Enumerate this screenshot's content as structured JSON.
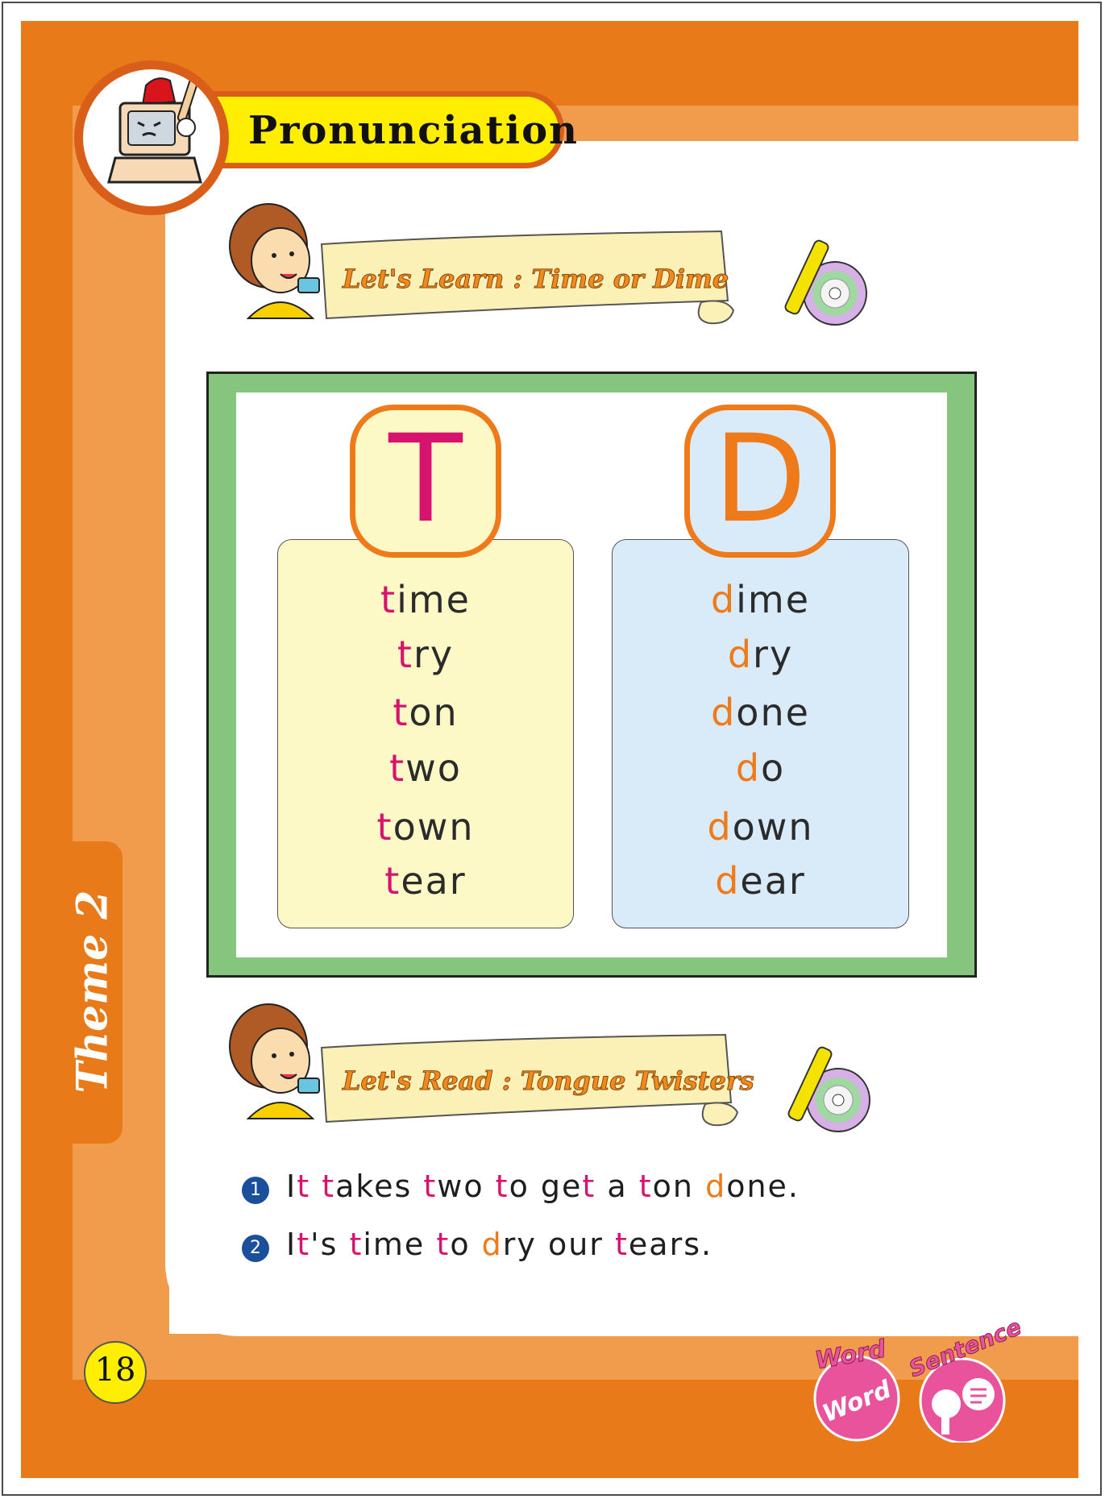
{
  "header": {
    "title": "Pronunciation"
  },
  "sections": {
    "learn": {
      "title": "Let's  Learn : Time or Dime"
    },
    "read": {
      "title": "Let's Read : Tongue Twisters"
    }
  },
  "t_column": {
    "letter": "T",
    "words": [
      {
        "first": "t",
        "rest": "ime"
      },
      {
        "first": "t",
        "rest": "ry"
      },
      {
        "first": "t",
        "rest": "on"
      },
      {
        "first": "t",
        "rest": "wo"
      },
      {
        "first": "t",
        "rest": "own"
      },
      {
        "first": "t",
        "rest": "ear"
      }
    ]
  },
  "d_column": {
    "letter": "D",
    "words": [
      {
        "first": "d",
        "rest": "ime"
      },
      {
        "first": "d",
        "rest": "ry"
      },
      {
        "first": "d",
        "rest": "one"
      },
      {
        "first": "d",
        "rest": "o"
      },
      {
        "first": "d",
        "rest": "own"
      },
      {
        "first": "d",
        "rest": "ear"
      }
    ]
  },
  "sentences": [
    {
      "number": "1",
      "parts": [
        {
          "text": "I",
          "c": "n"
        },
        {
          "text": "t",
          "c": "t"
        },
        {
          "text": " ",
          "c": "n"
        },
        {
          "text": "t",
          "c": "t"
        },
        {
          "text": "akes ",
          "c": "n"
        },
        {
          "text": "t",
          "c": "t"
        },
        {
          "text": "wo ",
          "c": "n"
        },
        {
          "text": "t",
          "c": "t"
        },
        {
          "text": "o ge",
          "c": "n"
        },
        {
          "text": "t",
          "c": "t"
        },
        {
          "text": " a ",
          "c": "n"
        },
        {
          "text": "t",
          "c": "t"
        },
        {
          "text": "on ",
          "c": "n"
        },
        {
          "text": "d",
          "c": "d"
        },
        {
          "text": "one.",
          "c": "n"
        }
      ]
    },
    {
      "number": "2",
      "parts": [
        {
          "text": "I",
          "c": "n"
        },
        {
          "text": "t",
          "c": "t"
        },
        {
          "text": "'s ",
          "c": "n"
        },
        {
          "text": "t",
          "c": "t"
        },
        {
          "text": "ime ",
          "c": "n"
        },
        {
          "text": "t",
          "c": "t"
        },
        {
          "text": "o ",
          "c": "n"
        },
        {
          "text": "d",
          "c": "d"
        },
        {
          "text": "ry our ",
          "c": "n"
        },
        {
          "text": "t",
          "c": "t"
        },
        {
          "text": "ears.",
          "c": "n"
        }
      ]
    }
  ],
  "theme_tab": "Theme 2",
  "page_number": "18",
  "badges": {
    "word_top": "Word",
    "word_inner": "Word",
    "sentence": "Sentence"
  },
  "colors": {
    "orange": "#e87a1a",
    "light_orange": "#f19b4c",
    "green": "#86c57e",
    "t_pink": "#d6146f",
    "d_orange": "#ee7a1a",
    "t_panel": "#fdf9c6",
    "d_panel": "#d9ebf8",
    "yellow": "#ffee00",
    "badge_pink": "#e9539c"
  }
}
